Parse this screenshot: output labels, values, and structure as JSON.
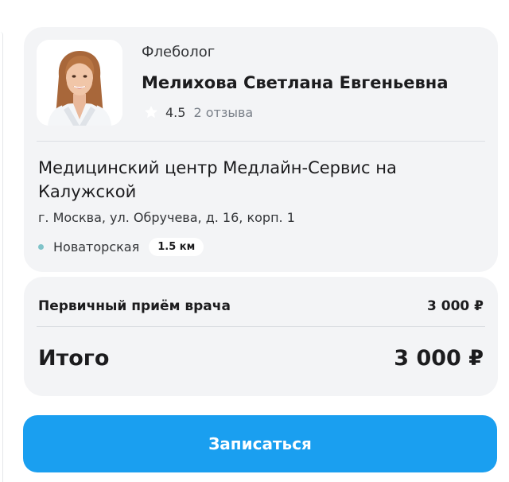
{
  "doctor": {
    "specialty": "Флеболог",
    "name": "Мелихова Светлана Евгеньевна",
    "rating": "4.5",
    "reviews": "2 отзыва",
    "photo_icon": "doctor-portrait"
  },
  "clinic": {
    "name": "Медицинский центр Медлайн-Сервис на Калужской",
    "address": "г. Москва, ул. Обручева, д. 16, корп. 1",
    "metro": "Новаторская",
    "distance": "1.5 км",
    "metro_color": "#7fc3c9"
  },
  "price": {
    "service_label": "Первичный приём врача",
    "service_price": "3 000 ₽",
    "total_label": "Итого",
    "total_price": "3 000 ₽"
  },
  "actions": {
    "book_label": "Записаться"
  },
  "colors": {
    "accent": "#1a9ff0",
    "card_bg": "#f3f4f6",
    "star": "#ffffff"
  }
}
